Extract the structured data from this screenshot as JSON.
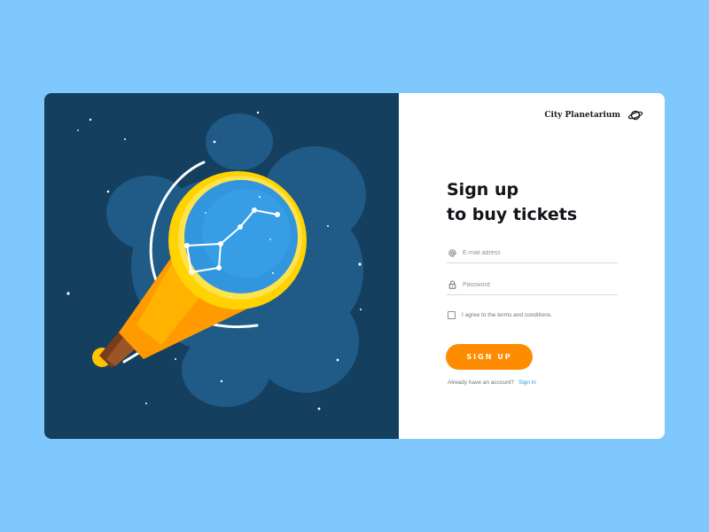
{
  "brand": {
    "name": "City Planetarium",
    "icon": "planet-icon"
  },
  "heading": {
    "line1": "Sign up",
    "line2": "to buy tickets"
  },
  "form": {
    "email": {
      "value": "",
      "placeholder": "E-mail adress",
      "icon": "at-icon"
    },
    "password": {
      "value": "",
      "placeholder": "Password",
      "icon": "lock-icon"
    },
    "terms": {
      "checked": false,
      "label": "I agree to the terms and conditions."
    },
    "submit_label": "SIGN UP",
    "signin_prompt": "Already have an account?",
    "signin_link": "Sign in"
  },
  "illustration": {
    "subject": "telescope-with-constellation",
    "icon": "telescope-icon"
  },
  "colors": {
    "page_background": "#7ec8fd",
    "illustration_background": "#143f5f",
    "nebula": "#1f5b86",
    "lens_blue": "#3296de",
    "telescope_yellow": "#ffd200",
    "telescope_orange": "#ff9a00",
    "accent_orange": "#ff8c00",
    "link_blue": "#2d9ce6",
    "heading_text": "#111418"
  }
}
